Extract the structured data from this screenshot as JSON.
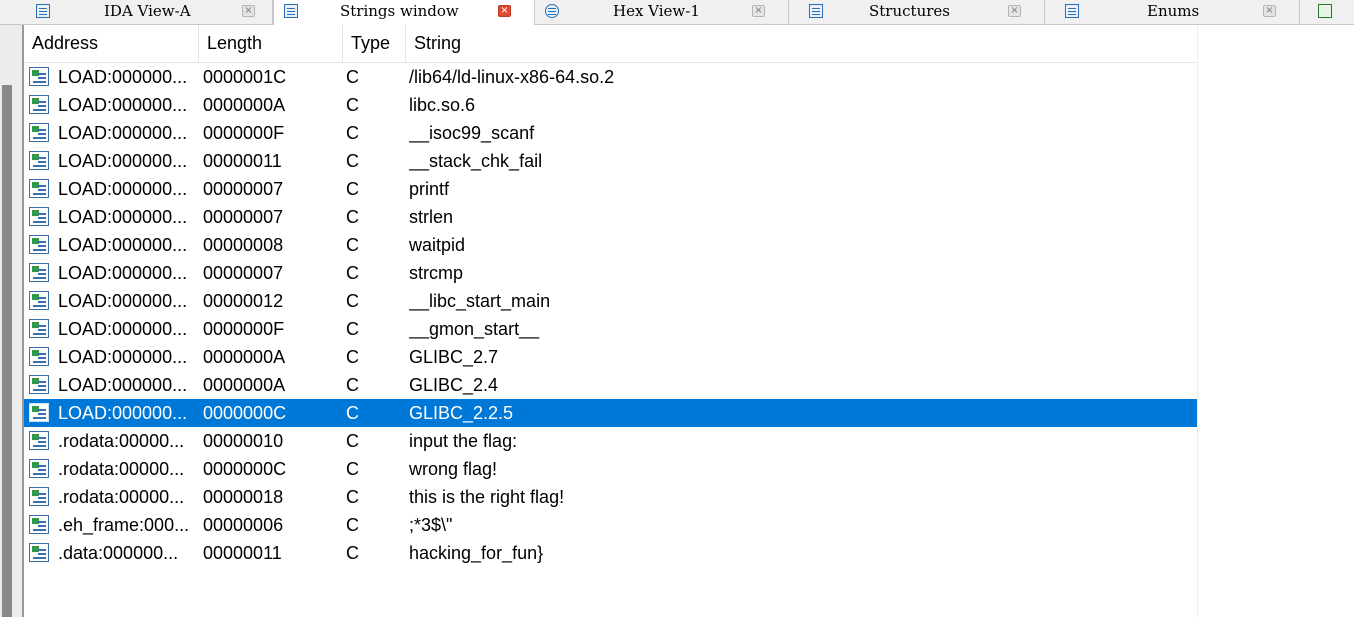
{
  "tabs": [
    {
      "label": "IDA View-A",
      "icon": "ida-view-icon",
      "active": false
    },
    {
      "label": "Strings window",
      "icon": "strings-icon",
      "active": true
    },
    {
      "label": "Hex View-1",
      "icon": "hex-view-icon",
      "active": false
    },
    {
      "label": "Structures",
      "icon": "structures-icon",
      "active": false
    },
    {
      "label": "Enums",
      "icon": "enums-icon",
      "active": false
    }
  ],
  "close_glyph": "×",
  "columns": {
    "address": "Address",
    "length": "Length",
    "type": "Type",
    "string": "String"
  },
  "rows": [
    {
      "address": "LOAD:000000...",
      "length": "0000001C",
      "type": "C",
      "string": "/lib64/ld-linux-x86-64.so.2"
    },
    {
      "address": "LOAD:000000...",
      "length": "0000000A",
      "type": "C",
      "string": "libc.so.6"
    },
    {
      "address": "LOAD:000000...",
      "length": "0000000F",
      "type": "C",
      "string": "__isoc99_scanf"
    },
    {
      "address": "LOAD:000000...",
      "length": "00000011",
      "type": "C",
      "string": "__stack_chk_fail"
    },
    {
      "address": "LOAD:000000...",
      "length": "00000007",
      "type": "C",
      "string": "printf"
    },
    {
      "address": "LOAD:000000...",
      "length": "00000007",
      "type": "C",
      "string": "strlen"
    },
    {
      "address": "LOAD:000000...",
      "length": "00000008",
      "type": "C",
      "string": "waitpid"
    },
    {
      "address": "LOAD:000000...",
      "length": "00000007",
      "type": "C",
      "string": "strcmp"
    },
    {
      "address": "LOAD:000000...",
      "length": "00000012",
      "type": "C",
      "string": "__libc_start_main"
    },
    {
      "address": "LOAD:000000...",
      "length": "0000000F",
      "type": "C",
      "string": "__gmon_start__"
    },
    {
      "address": "LOAD:000000...",
      "length": "0000000A",
      "type": "C",
      "string": "GLIBC_2.7"
    },
    {
      "address": "LOAD:000000...",
      "length": "0000000A",
      "type": "C",
      "string": "GLIBC_2.4"
    },
    {
      "address": "LOAD:000000...",
      "length": "0000000C",
      "type": "C",
      "string": "GLIBC_2.2.5",
      "selected": true
    },
    {
      "address": ".rodata:00000...",
      "length": "00000010",
      "type": "C",
      "string": "input the flag:"
    },
    {
      "address": ".rodata:00000...",
      "length": "0000000C",
      "type": "C",
      "string": "wrong flag!"
    },
    {
      "address": ".rodata:00000...",
      "length": "00000018",
      "type": "C",
      "string": "this is the right flag!"
    },
    {
      "address": ".eh_frame:000...",
      "length": "00000006",
      "type": "C",
      "string": ";*3$\\\""
    },
    {
      "address": ".data:000000...",
      "length": "00000011",
      "type": "C",
      "string": "hacking_for_fun}"
    }
  ],
  "colors": {
    "selection": "#0078d7",
    "active_close": "#e04a32"
  }
}
